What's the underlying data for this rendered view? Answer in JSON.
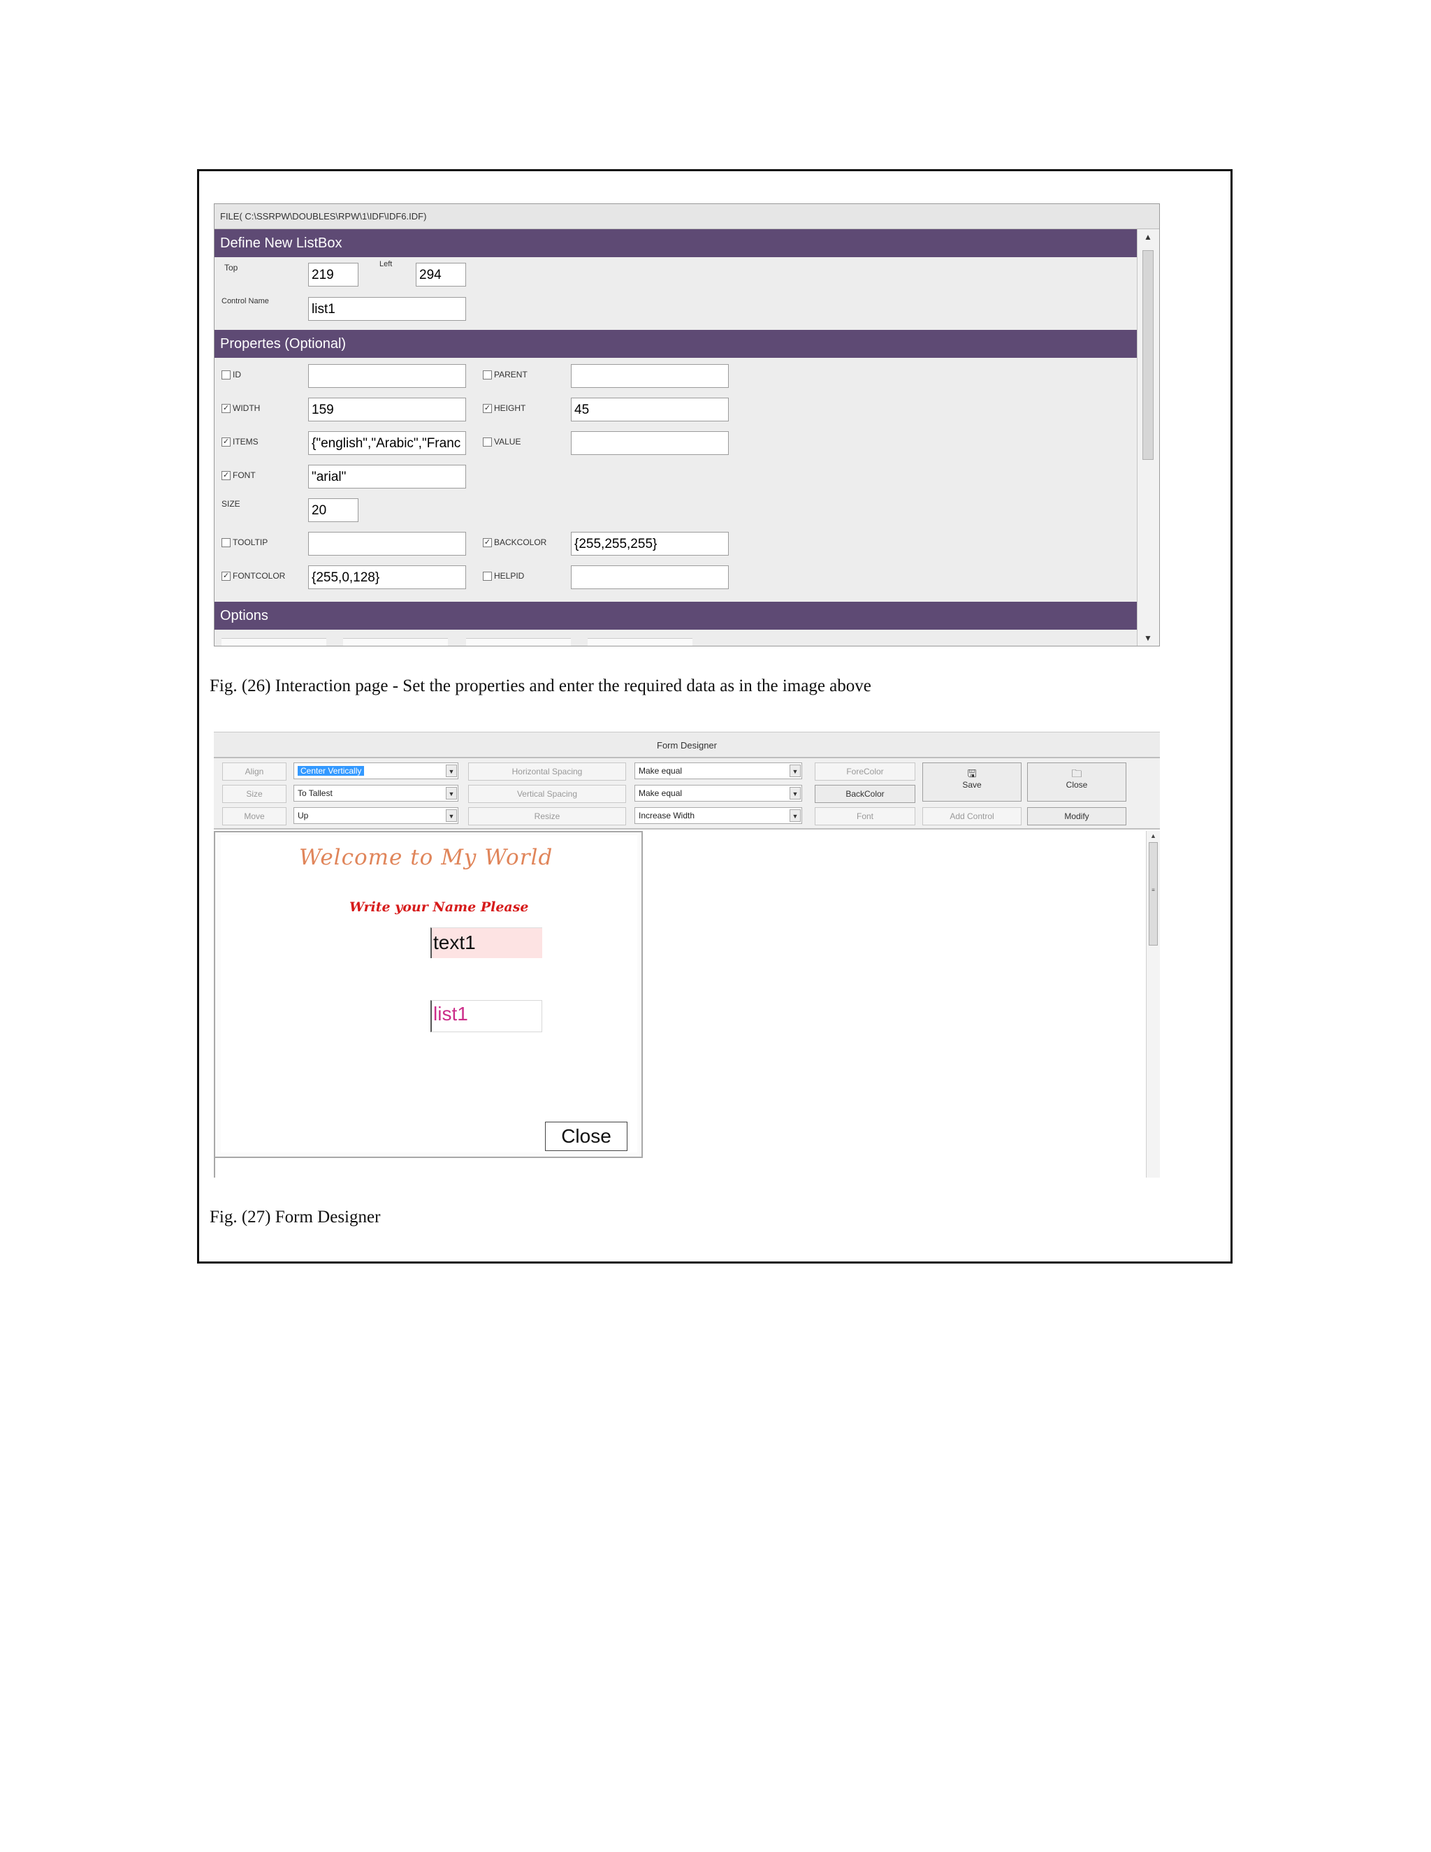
{
  "fig26": {
    "file_bar": "FILE( C:\\SSRPW\\DOUBLES\\RPW\\1\\IDF\\IDF6.IDF)",
    "section_define": "Define New ListBox",
    "top_label": "Top",
    "top_value": "219",
    "left_label": "Left",
    "left_value": "294",
    "control_name_label": "Control Name",
    "control_name_value": "list1",
    "section_properties": "Propertes (Optional)",
    "properties": {
      "id": {
        "label": "ID",
        "checked": false,
        "value": ""
      },
      "parent": {
        "label": "PARENT",
        "checked": false,
        "value": ""
      },
      "width": {
        "label": "WIDTH",
        "checked": true,
        "value": "159"
      },
      "height": {
        "label": "HEIGHT",
        "checked": true,
        "value": "45"
      },
      "items": {
        "label": "ITEMS",
        "checked": true,
        "value": "{\"english\",\"Arabic\",\"Franc"
      },
      "value": {
        "label": "VALUE",
        "checked": false,
        "value": ""
      },
      "font": {
        "label": "FONT",
        "checked": true,
        "value": "\"arial\""
      },
      "size": {
        "label": "SIZE",
        "value": "20"
      },
      "tooltip": {
        "label": "TOOLTIP",
        "checked": false,
        "value": ""
      },
      "backcolor": {
        "label": "BACKCOLOR",
        "checked": true,
        "value": "{255,255,255}"
      },
      "fontcolor": {
        "label": "FONTCOLOR",
        "checked": true,
        "value": "{255,0,128}"
      },
      "helpid": {
        "label": "HELPID",
        "checked": false,
        "value": ""
      }
    },
    "section_options": "Options",
    "check_mark": "✓",
    "caption": "Fig. (26) Interaction page - Set the properties and enter the required data as in the image above"
  },
  "fig27": {
    "title": "Form Designer",
    "toolbar": {
      "align_btn": "Align",
      "size_btn": "Size",
      "move_btn": "Move",
      "align_value": "Center Vertically",
      "size_value": "To Tallest",
      "move_value": "Up",
      "hspacing_btn": "Horizontal Spacing",
      "vspacing_btn": "Vertical Spacing",
      "resize_btn": "Resize",
      "hspacing_value": "Make equal",
      "vspacing_value": "Make equal",
      "resize_value": "Increase Width",
      "forecolor_btn": "ForeColor",
      "backcolor_btn": "BackColor",
      "font_btn": "Font",
      "save_btn": "Save",
      "close_btn": "Close",
      "add_control_btn": "Add Control",
      "modify_btn": "Modify"
    },
    "form": {
      "welcome": "Welcome to My World",
      "prompt": "Write your Name Please",
      "text_control": "text1",
      "list_control": "list1",
      "close_button": "Close"
    },
    "colors": {
      "welcome": "#e0855a",
      "prompt": "#d61a1a",
      "list_text": "#cc2e8a",
      "text_bg": "#fde3e3",
      "header_bar": "#5e4a74"
    },
    "caption": "Fig. (27) Form Designer"
  }
}
